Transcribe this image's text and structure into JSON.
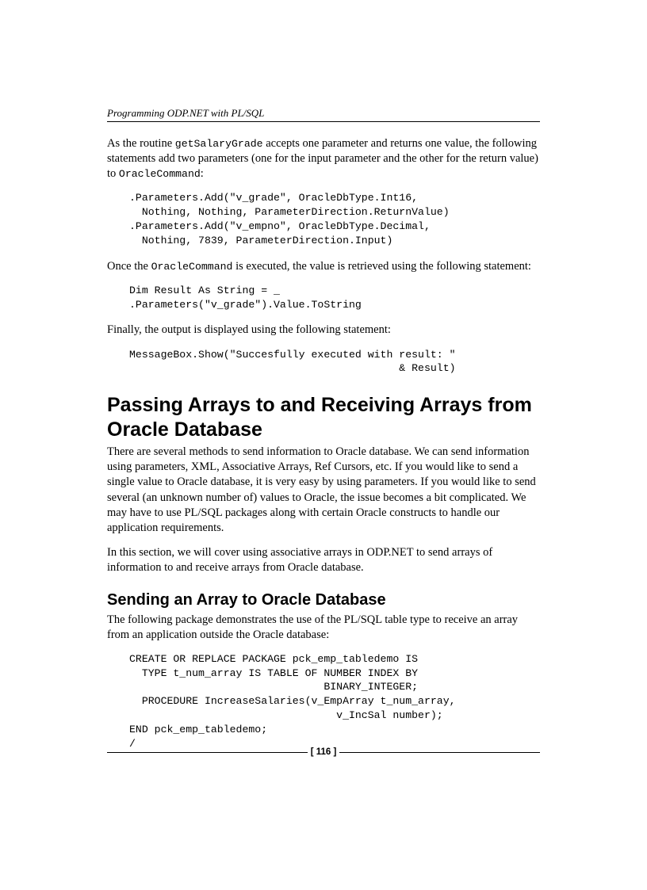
{
  "running_head": "Programming ODP.NET with PL/SQL",
  "para1_a": "As the routine ",
  "para1_code1": "getSalaryGrade",
  "para1_b": " accepts one parameter and returns one value, the following statements add two parameters (one for the input parameter and the other for the return value) to ",
  "para1_code2": "OracleCommand",
  "para1_c": ":",
  "code1": ".Parameters.Add(\"v_grade\", OracleDbType.Int16,\n  Nothing, Nothing, ParameterDirection.ReturnValue)\n.Parameters.Add(\"v_empno\", OracleDbType.Decimal,\n  Nothing, 7839, ParameterDirection.Input)",
  "para2_a": "Once the ",
  "para2_code1": "OracleCommand",
  "para2_b": " is executed, the value is retrieved using the following statement:",
  "code2": "Dim Result As String = _\n.Parameters(\"v_grade\").Value.ToString",
  "para3": "Finally, the output is displayed using the following statement:",
  "code3": "MessageBox.Show(\"Succesfully executed with result: \"\n                                           & Result)",
  "h1": "Passing Arrays to and Receiving Arrays from Oracle Database",
  "para4": "There are several methods to send information to Oracle database. We can send information using parameters, XML, Associative Arrays, Ref Cursors, etc. If you would like to send a single value to Oracle database, it is very easy by using parameters. If you would like to send several (an unknown number of) values to Oracle, the issue becomes a bit complicated. We may have to use PL/SQL packages along with certain Oracle constructs to handle our application requirements.",
  "para5": "In this section, we will cover using associative arrays in ODP.NET to send arrays of information to and receive arrays from Oracle database.",
  "h2": "Sending an Array to Oracle Database",
  "para6": "The following package demonstrates the use of the PL/SQL table type to receive an array from an application outside the Oracle database:",
  "code4": "CREATE OR REPLACE PACKAGE pck_emp_tabledemo IS\n  TYPE t_num_array IS TABLE OF NUMBER INDEX BY\n                               BINARY_INTEGER;\n  PROCEDURE IncreaseSalaries(v_EmpArray t_num_array,\n                                 v_IncSal number);\nEND pck_emp_tabledemo;\n/",
  "page_number": "[ 116 ]"
}
